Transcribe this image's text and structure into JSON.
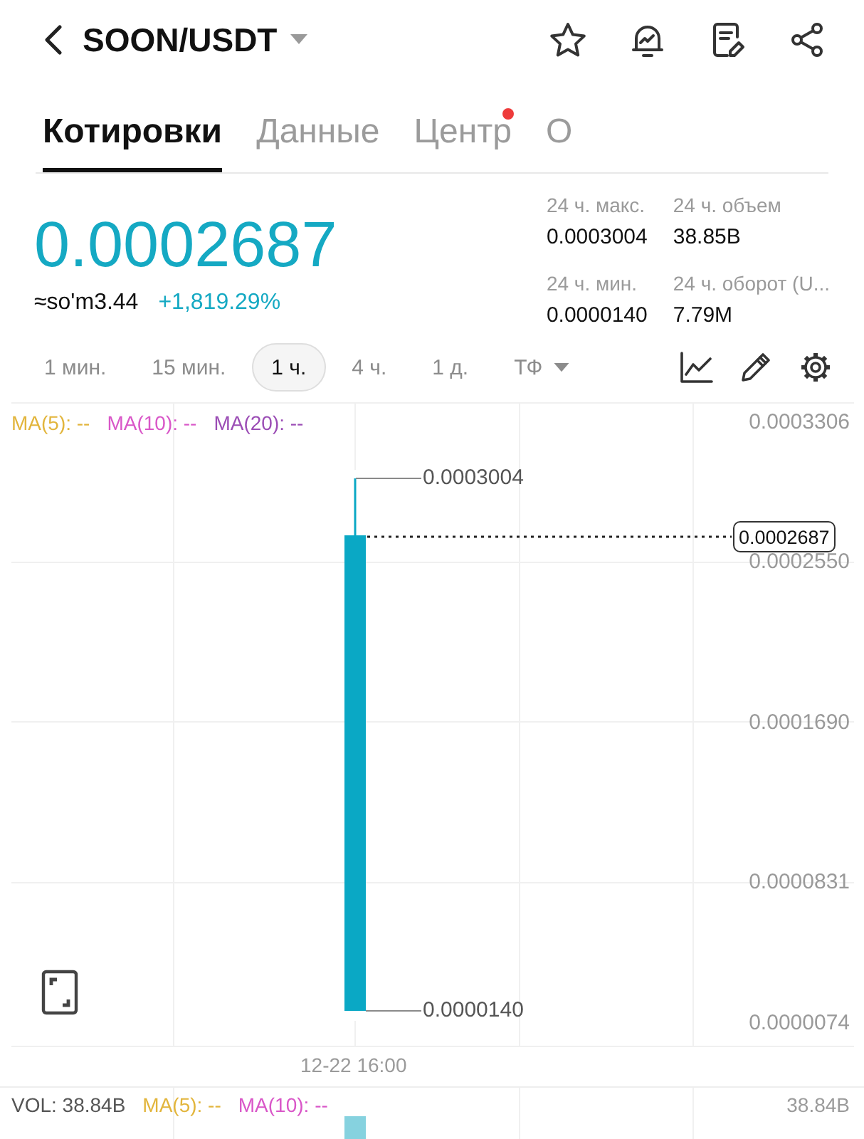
{
  "header": {
    "title": "SOON/USDT"
  },
  "tabs": [
    {
      "label": "Котировки",
      "selected": true,
      "badge": false
    },
    {
      "label": "Данные",
      "selected": false,
      "badge": false
    },
    {
      "label": "Центр",
      "selected": false,
      "badge": true
    },
    {
      "label": "О",
      "selected": false,
      "badge": false
    }
  ],
  "ticker": {
    "price": "0.0002687",
    "local_price": "≈so'm3.44",
    "change": "+1,819.29%"
  },
  "stats": [
    {
      "label": "24 ч. макс.",
      "value": "0.0003004"
    },
    {
      "label": "24 ч. объем",
      "value": "38.85B"
    },
    {
      "label": "24 ч. мин.",
      "value": "0.0000140"
    },
    {
      "label": "24 ч. оборот (U...",
      "value": "7.79M"
    }
  ],
  "timeframes": [
    {
      "label": "1 мин.",
      "selected": false,
      "kind": "option"
    },
    {
      "label": "15 мин.",
      "selected": false,
      "kind": "option"
    },
    {
      "label": "1 ч.",
      "selected": true,
      "kind": "option"
    },
    {
      "label": "4 ч.",
      "selected": false,
      "kind": "option"
    },
    {
      "label": "1 д.",
      "selected": false,
      "kind": "option"
    },
    {
      "label": "ТФ",
      "selected": false,
      "kind": "dropdown"
    }
  ],
  "chart": {
    "indicators": [
      {
        "label": "MA(5): --",
        "color": "#e2b53c"
      },
      {
        "label": "MA(10): --",
        "color": "#d957c8"
      },
      {
        "label": "MA(20): --",
        "color": "#9b4db5"
      }
    ],
    "price_axis": [
      "0.0003306",
      "0.0002550",
      "0.0001690",
      "0.0000831",
      "0.0000074"
    ],
    "high_label": "0.0003004",
    "low_label": "0.0000140",
    "last_price": "0.0002687",
    "time_label": "12-22 16:00"
  },
  "volume": {
    "label": "VOL: 38.84B",
    "indicators": [
      {
        "label": "MA(5): --",
        "color": "#e2b53c"
      },
      {
        "label": "MA(10): --",
        "color": "#d957c8"
      }
    ],
    "axis_max": "38.84B"
  }
}
